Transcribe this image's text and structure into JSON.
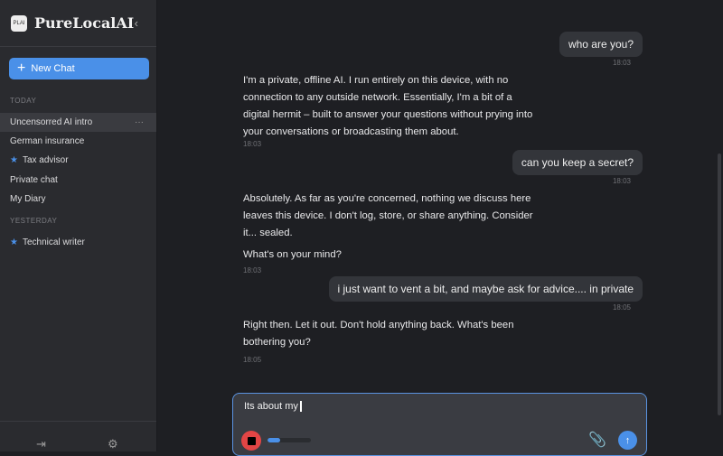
{
  "sidebar": {
    "app_name": "PureLocalAI",
    "logo_text": "PLAI",
    "new_chat": "New Chat",
    "today_label": "TODAY",
    "yesterday_label": "YESTERDAY",
    "today": [
      {
        "label": "Uncensorred AI intro",
        "starred": false
      },
      {
        "label": "German insurance",
        "starred": false
      },
      {
        "label": "Tax advisor",
        "starred": true
      },
      {
        "label": "Private chat",
        "starred": false
      },
      {
        "label": "My Diary",
        "starred": false
      }
    ],
    "yesterday": [
      {
        "label": "Technical writer",
        "starred": true
      }
    ],
    "more": "···"
  },
  "messages": [
    {
      "role": "user",
      "text": "who are you?",
      "time": "18:03"
    },
    {
      "role": "ai",
      "paras": [
        "I'm a private, offline AI. I run entirely on this device, with no connection to any outside network. Essentially, I'm a bit of a digital hermit – built to answer your questions without prying into your conversations or broadcasting them about."
      ],
      "time": "18:03"
    },
    {
      "role": "user",
      "text": "can you keep a secret?",
      "time": "18:03"
    },
    {
      "role": "ai",
      "paras": [
        "Absolutely. As far as you're concerned, nothing we discuss here leaves this device. I don't log, store, or share anything. Consider it... sealed.",
        "What's on your mind?"
      ],
      "time": "18:03"
    },
    {
      "role": "user",
      "text": "i just want to vent a bit, and maybe ask for advice.... in private",
      "time": "18:05"
    },
    {
      "role": "ai",
      "paras": [
        "Right then. Let it out. Don't hold anything back. What's been bothering you?"
      ],
      "time": "18:05"
    }
  ],
  "composer": {
    "value": "Its about my",
    "progress_percent": 30
  },
  "colors": {
    "accent": "#4a90e8",
    "stop": "#e24545"
  }
}
